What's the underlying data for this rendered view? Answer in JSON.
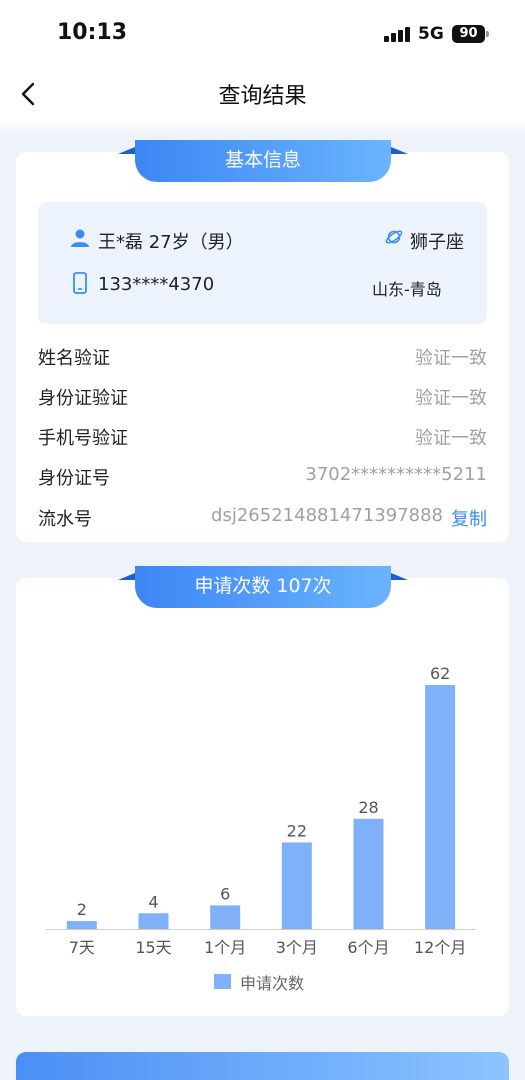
{
  "status_bar": {
    "time": "10:13",
    "network": "5G",
    "battery": "90"
  },
  "nav": {
    "title": "查询结果"
  },
  "basic_info": {
    "heading": "基本信息",
    "person": "王*磊  27岁（男）",
    "zodiac": "狮子座",
    "phone": "133****4370",
    "region": "山东-青岛",
    "rows": [
      {
        "label": "姓名验证",
        "value": "验证一致"
      },
      {
        "label": "身份证验证",
        "value": "验证一致"
      },
      {
        "label": "手机号验证",
        "value": "验证一致"
      },
      {
        "label": "身份证号",
        "value": "3702**********5211"
      }
    ],
    "serial": {
      "label": "流水号",
      "value": "dsj265214881471397888",
      "copy": "复制"
    }
  },
  "application": {
    "heading": "申请次数 107次"
  },
  "chart_data": {
    "type": "bar",
    "categories": [
      "7天",
      "15天",
      "1个月",
      "3个月",
      "6个月",
      "12个月"
    ],
    "series": [
      {
        "name": "申请次数",
        "values": [
          2,
          4,
          6,
          22,
          28,
          62
        ]
      }
    ],
    "data_labels": [
      "2",
      "4",
      "6",
      "22",
      "28",
      "62"
    ],
    "ylim": [
      0,
      62
    ],
    "grid": false,
    "legend": "bottom-center",
    "bar_color": "#7fb0f8"
  },
  "colors": {
    "accent": "#3a8ef0",
    "ribbon_start": "#3d86f5",
    "ribbon_end": "#6ab4ff"
  },
  "icons": {
    "back": "chevron-left-icon",
    "person": "person-icon",
    "phone": "phone-icon",
    "zodiac": "planet-icon"
  }
}
